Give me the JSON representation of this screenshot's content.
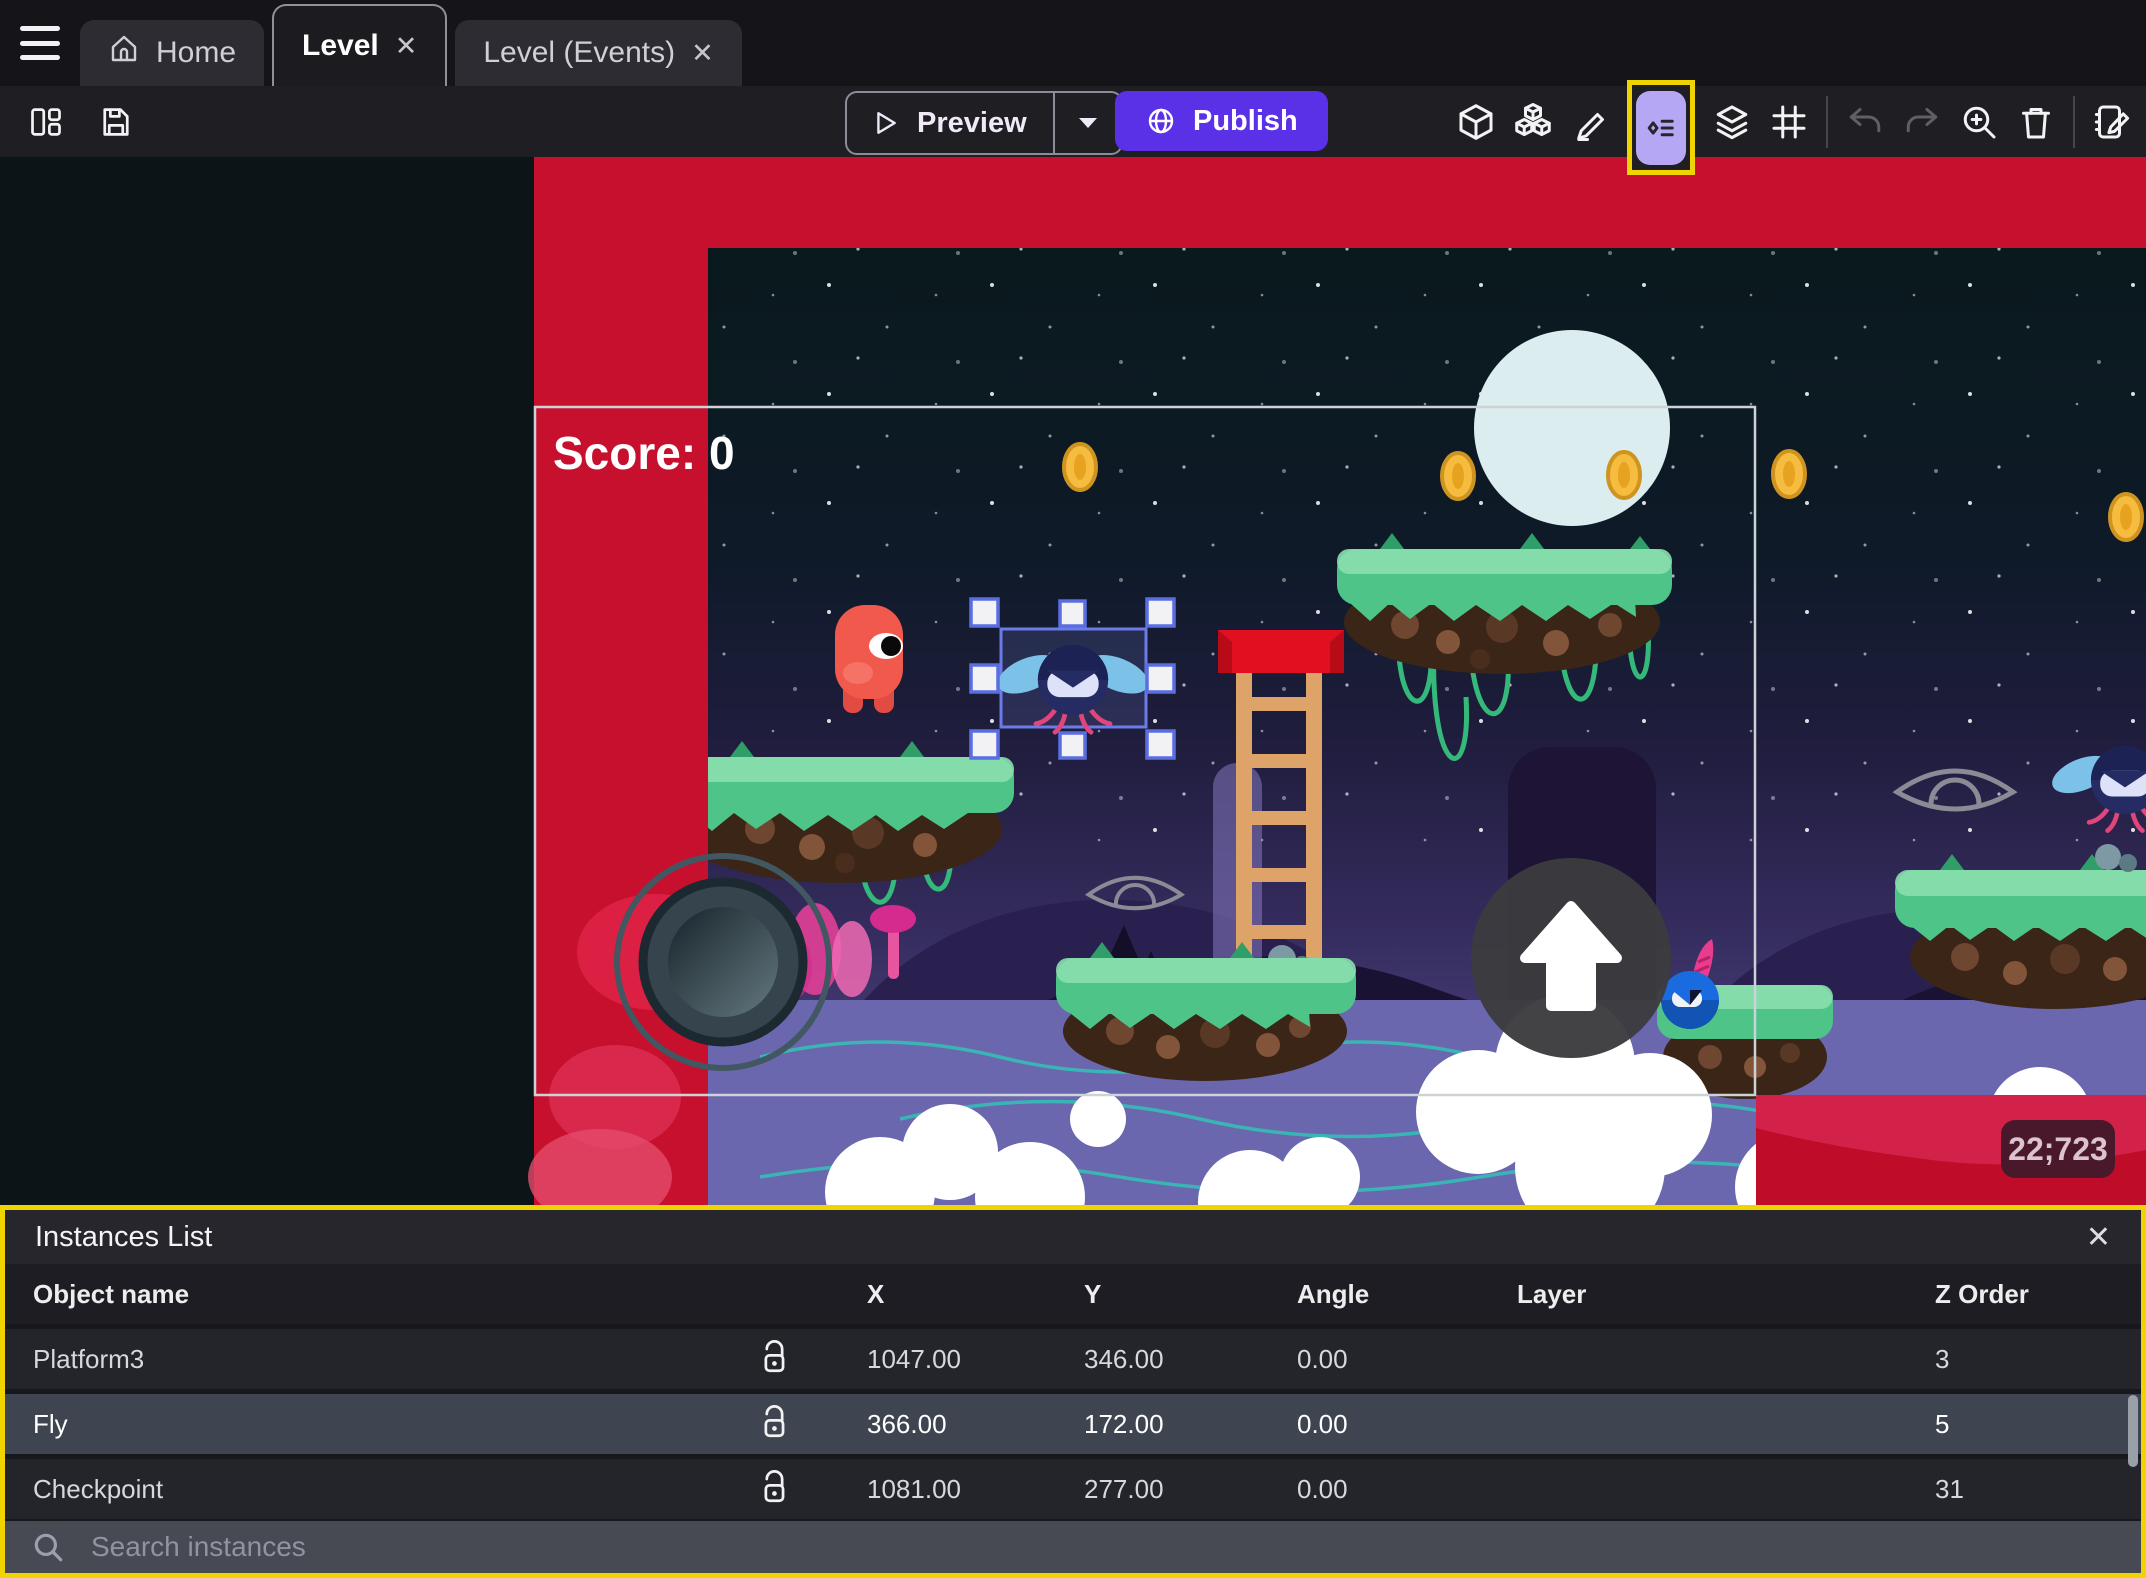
{
  "tab_bar": {
    "home_label": "Home",
    "level_label": "Level",
    "level_events_label": "Level (Events)"
  },
  "toolbar": {
    "preview_label": "Preview",
    "publish_label": "Publish",
    "icons": [
      "objects-cube",
      "object-groups",
      "edit-scene",
      "instances-list",
      "layers",
      "grid",
      "undo",
      "redo",
      "zoom-in",
      "delete",
      "edit-properties"
    ]
  },
  "scene": {
    "score_text": "Score: 0",
    "cursor_coordinates": "22;723"
  },
  "instances_panel": {
    "title": "Instances List",
    "columns": [
      "Object name",
      "X",
      "Y",
      "Angle",
      "Layer",
      "Z Order"
    ],
    "rows": [
      {
        "name": "Platform3",
        "x": "1047.00",
        "y": "346.00",
        "angle": "0.00",
        "layer": "",
        "z_order": "3"
      },
      {
        "name": "Fly",
        "x": "366.00",
        "y": "172.00",
        "angle": "0.00",
        "layer": "",
        "z_order": "5"
      },
      {
        "name": "Checkpoint",
        "x": "1081.00",
        "y": "277.00",
        "angle": "0.00",
        "layer": "",
        "z_order": "31"
      }
    ],
    "search_placeholder": "Search instances"
  },
  "glyphs": {
    "close": "✕"
  },
  "colors": {
    "highlight_yellow": "#f0d400",
    "publish_purple": "#5a31e6",
    "active_tool_purple": "#b5a7f3",
    "scene_red": "#c6102d",
    "selected_row": "#3e4450"
  }
}
